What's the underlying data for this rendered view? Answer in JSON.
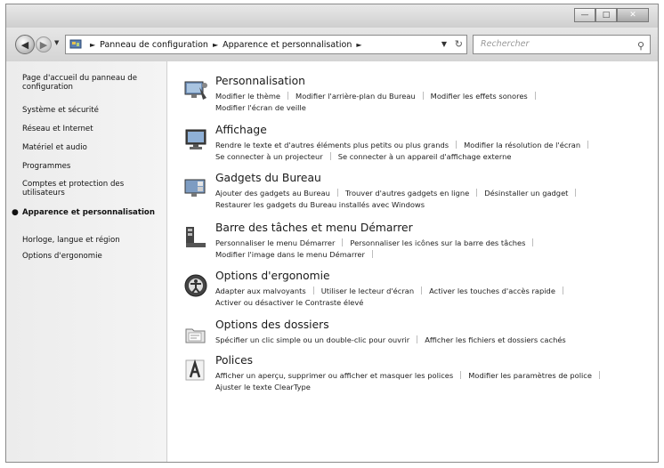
{
  "colors": {
    "window_bg": "#dcdcdc",
    "content_bg": "#ffffff",
    "sidebar_bg": "#f0f0f0",
    "text": "#1a1a1a"
  },
  "address_bar": {
    "crumbs": [
      "Panneau de configuration",
      "Apparence et personnalisation"
    ],
    "search_placeholder": "Rechercher"
  },
  "sidebar": {
    "items": [
      {
        "label": "Page d'accueil du panneau de configuration"
      },
      {
        "label": "Système et sécurité"
      },
      {
        "label": "Réseau et Internet"
      },
      {
        "label": "Matériel et audio"
      },
      {
        "label": "Programmes"
      },
      {
        "label": "Comptes et protection des utilisateurs"
      },
      {
        "label": "Apparence et personnalisation",
        "active": true
      },
      {
        "label": "Horloge, langue et région"
      },
      {
        "label": "Options d'ergonomie"
      }
    ]
  },
  "categories": [
    {
      "title": "Personnalisation",
      "icon": "personalization-icon",
      "links": [
        "Modifier le thème",
        "Modifier l'arrière-plan du Bureau",
        "Modifier les effets sonores",
        "Modifier l'écran de veille"
      ]
    },
    {
      "title": "Affichage",
      "icon": "display-icon",
      "links": [
        "Rendre le texte et d'autres éléments plus petits ou plus grands",
        "Modifier la résolution de l'écran",
        "Se connecter à un projecteur",
        "Se connecter à un appareil d'affichage externe"
      ]
    },
    {
      "title": "Gadgets du Bureau",
      "icon": "gadgets-icon",
      "links": [
        "Ajouter des gadgets au Bureau",
        "Trouver d'autres gadgets en ligne",
        "Désinstaller un gadget",
        "Restaurer les gadgets du Bureau installés avec Windows"
      ]
    },
    {
      "title": "Barre des tâches et menu Démarrer",
      "icon": "taskbar-icon",
      "links": [
        "Personnaliser le menu Démarrer",
        "Personnaliser les icônes sur la barre des tâches",
        "Modifier l'image dans le menu Démarrer"
      ]
    },
    {
      "title": "Options d'ergonomie",
      "icon": "ease-of-access-icon",
      "links": [
        "Adapter aux malvoyants",
        "Utiliser le lecteur d'écran",
        "Activer les touches d'accès rapide",
        "Activer ou désactiver le Contraste élevé"
      ]
    },
    {
      "title": "Options des dossiers",
      "icon": "folder-options-icon",
      "links": [
        "Spécifier un clic simple ou un double-clic pour ouvrir",
        "Afficher les fichiers et dossiers cachés"
      ]
    },
    {
      "title": "Polices",
      "icon": "fonts-icon",
      "links": [
        "Afficher un aperçu, supprimer ou afficher et masquer les polices",
        "Modifier les paramètres de police",
        "Ajuster le texte ClearType"
      ]
    }
  ]
}
